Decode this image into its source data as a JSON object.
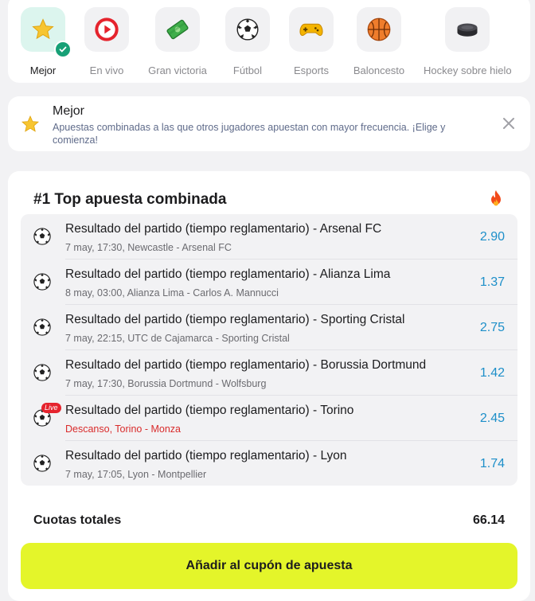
{
  "categories": [
    {
      "label": "Mejor",
      "icon": "star-icon",
      "active": true
    },
    {
      "label": "En vivo",
      "icon": "play-icon",
      "active": false
    },
    {
      "label": "Gran victoria",
      "icon": "money-icon",
      "active": false
    },
    {
      "label": "Fútbol",
      "icon": "soccer-ball-icon",
      "active": false
    },
    {
      "label": "Esports",
      "icon": "gamepad-icon",
      "active": false
    },
    {
      "label": "Baloncesto",
      "icon": "basketball-icon",
      "active": false
    },
    {
      "label": "Hockey sobre hielo",
      "icon": "hockey-puck-icon",
      "active": false
    }
  ],
  "info": {
    "title": "Mejor",
    "description": "Apuestas combinadas a las que otros jugadores apuestan con mayor frecuencia. ¡Elige y comienza!"
  },
  "combo": {
    "title": "#1 Top apuesta combinada",
    "bets": [
      {
        "name": "Resultado del partido (tiempo reglamentario) - Arsenal FC",
        "meta": "7 may, 17:30, Newcastle - Arsenal FC",
        "odd": "2.90",
        "live": false
      },
      {
        "name": "Resultado del partido (tiempo reglamentario) - Alianza Lima",
        "meta": "8 may, 03:00, Alianza Lima - Carlos A. Mannucci",
        "odd": "1.37",
        "live": false
      },
      {
        "name": "Resultado del partido (tiempo reglamentario) - Sporting Cristal",
        "meta": "7 may, 22:15, UTC de Cajamarca - Sporting Cristal",
        "odd": "2.75",
        "live": false
      },
      {
        "name": "Resultado del partido (tiempo reglamentario) - Borussia Dortmund",
        "meta": "7 may, 17:30, Borussia Dortmund - Wolfsburg",
        "odd": "1.42",
        "live": false
      },
      {
        "name": "Resultado del partido (tiempo reglamentario) - Torino",
        "meta": "Descanso, Torino - Monza",
        "odd": "2.45",
        "live": true,
        "live_label": "Live"
      },
      {
        "name": "Resultado del partido (tiempo reglamentario) - Lyon",
        "meta": "7 may, 17:05, Lyon - Montpellier",
        "odd": "1.74",
        "live": false
      }
    ],
    "total_label": "Cuotas totales",
    "total_value": "66.14",
    "add_button": "Añadir al cupón de apuesta"
  },
  "colors": {
    "accent_button": "#e4f52a",
    "odds": "#1d8fc9",
    "live": "#e5232d",
    "active_check": "#17a076"
  }
}
